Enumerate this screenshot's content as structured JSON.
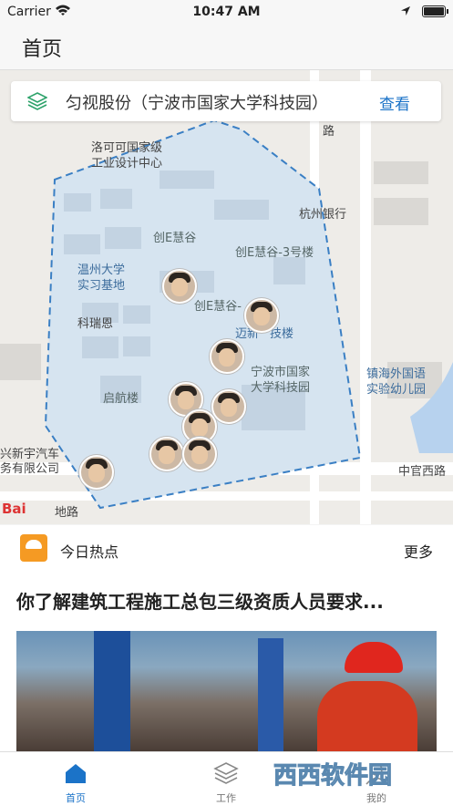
{
  "status_bar": {
    "carrier": "Carrier",
    "time": "10:47 AM"
  },
  "nav": {
    "title": "首页"
  },
  "company_card": {
    "name": "匀视股份（宁波市国家大学科技园）",
    "action": "查看",
    "icon": "layers-icon"
  },
  "map": {
    "labels": {
      "l1": "洛可可国家级",
      "l2": "工业设计中心",
      "l3": "创E慧谷",
      "l4": "创E慧谷-3号楼",
      "l5": "杭州银行",
      "l6": "温州大学",
      "l7": "实习基地",
      "l8": "科瑞恩",
      "l9": "创E慧谷-",
      "l10": "迈新",
      "l11": "技楼",
      "l12": "宁波市国家",
      "l13": "大学科技园",
      "l14": "启航楼",
      "l15": "镇海外国语",
      "l16": "实验幼儿园",
      "l17": "兴新宇汽车",
      "l18": "务有限公司",
      "l19": "中官西路",
      "l20": "路",
      "l21": "地路"
    },
    "logo_text": "Bai"
  },
  "hot": {
    "label": "今日热点",
    "more": "更多"
  },
  "article": {
    "headline": "你了解建筑工程施工总包三级资质人员要求..."
  },
  "tabs": [
    {
      "label": "首页",
      "icon": "home-icon"
    },
    {
      "label": "工作",
      "icon": "layers-icon"
    },
    {
      "label": "我的",
      "icon": "user-icon"
    }
  ],
  "watermark": "西西软件园",
  "colors": {
    "accent": "#1b73c8",
    "boundary": "#3a7fc4",
    "area_fill": "#d6e4f0"
  }
}
